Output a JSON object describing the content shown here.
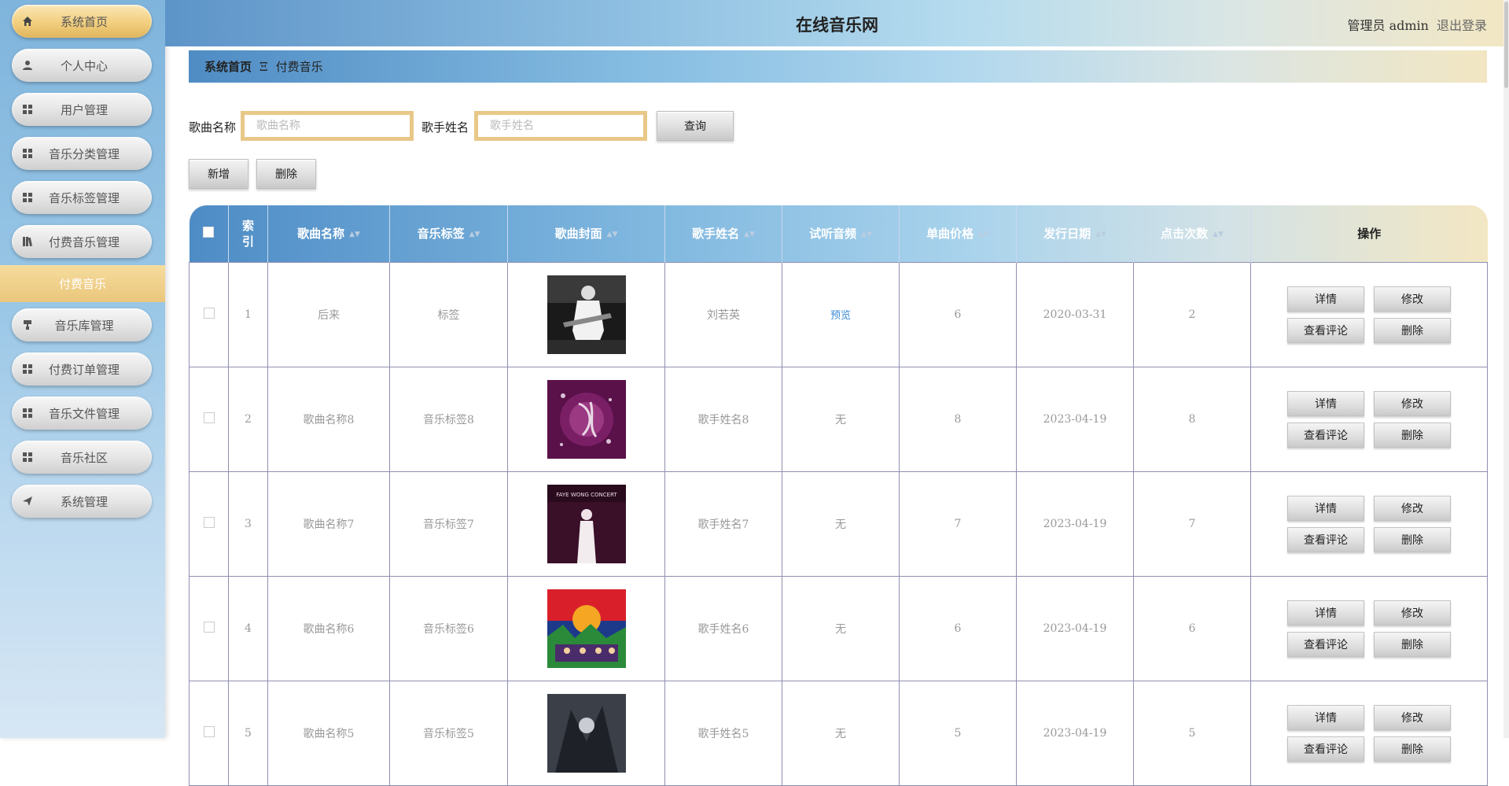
{
  "header": {
    "title": "在线音乐网",
    "user_label": "管理员 admin",
    "logout_label": "退出登录"
  },
  "sidebar": {
    "items": [
      {
        "label": "系统首页",
        "icon": "home-icon"
      },
      {
        "label": "个人中心",
        "icon": "user-icon"
      },
      {
        "label": "用户管理",
        "icon": "grid-icon"
      },
      {
        "label": "音乐分类管理",
        "icon": "grid-icon"
      },
      {
        "label": "音乐标签管理",
        "icon": "grid-icon"
      },
      {
        "label": "付费音乐管理",
        "icon": "books-icon"
      },
      {
        "label": "音乐库管理",
        "icon": "paint-roller-icon"
      },
      {
        "label": "付费订单管理",
        "icon": "grid-icon"
      },
      {
        "label": "音乐文件管理",
        "icon": "grid-icon"
      },
      {
        "label": "音乐社区",
        "icon": "grid-icon"
      },
      {
        "label": "系统管理",
        "icon": "send-icon"
      }
    ],
    "sub_item": "付费音乐"
  },
  "breadcrumb": {
    "home": "系统首页",
    "separator": "Ξ",
    "current": "付费音乐"
  },
  "search": {
    "song_label": "歌曲名称",
    "song_placeholder": "歌曲名称",
    "singer_label": "歌手姓名",
    "singer_placeholder": "歌手姓名",
    "query_label": "查询"
  },
  "actions": {
    "add_label": "新增",
    "delete_label": "删除"
  },
  "table": {
    "headers": {
      "index": "索引",
      "song": "歌曲名称",
      "tag": "音乐标签",
      "cover": "歌曲封面",
      "singer": "歌手姓名",
      "audio": "试听音频",
      "price": "单曲价格",
      "date": "发行日期",
      "clicks": "点击次数",
      "ops": "操作"
    },
    "row_buttons": {
      "detail": "详情",
      "edit": "修改",
      "comments": "查看评论",
      "delete": "删除"
    },
    "rows": [
      {
        "index": "1",
        "song": "后来",
        "tag": "标签",
        "singer": "刘若英",
        "audio": "预览",
        "price": "6",
        "date": "2020-03-31",
        "clicks": "2"
      },
      {
        "index": "2",
        "song": "歌曲名称8",
        "tag": "音乐标签8",
        "singer": "歌手姓名8",
        "audio": "无",
        "price": "8",
        "date": "2023-04-19",
        "clicks": "8"
      },
      {
        "index": "3",
        "song": "歌曲名称7",
        "tag": "音乐标签7",
        "singer": "歌手姓名7",
        "audio": "无",
        "price": "7",
        "date": "2023-04-19",
        "clicks": "7"
      },
      {
        "index": "4",
        "song": "歌曲名称6",
        "tag": "音乐标签6",
        "singer": "歌手姓名6",
        "audio": "无",
        "price": "6",
        "date": "2023-04-19",
        "clicks": "6"
      },
      {
        "index": "5",
        "song": "歌曲名称5",
        "tag": "音乐标签5",
        "singer": "歌手姓名5",
        "audio": "无",
        "price": "5",
        "date": "2023-04-19",
        "clicks": "5"
      }
    ],
    "cover_texts": {
      "row3": "FAYE WONG CONCERT"
    }
  }
}
